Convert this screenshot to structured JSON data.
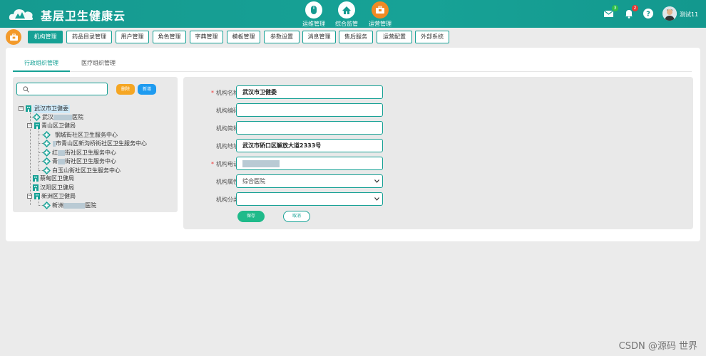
{
  "header": {
    "app_title": "基层卫生健康云",
    "nav": [
      {
        "label": "运维管理",
        "icon": "mouse-icon"
      },
      {
        "label": "综合监管",
        "icon": "home-icon"
      },
      {
        "label": "运营管理",
        "icon": "briefcase-icon",
        "active": true
      }
    ],
    "mail_count": "3",
    "notice_count": "2",
    "username": "测试11",
    "accent_color": "#16a195"
  },
  "module_tabs": [
    "机构管理",
    "药品目录管理",
    "用户管理",
    "角色管理",
    "字典管理",
    "模板管理",
    "参数设置",
    "消息管理",
    "售后服务",
    "运营配置",
    "外部系统"
  ],
  "sub_tabs": [
    "行政组织管理",
    "医疗组织管理"
  ],
  "tree": {
    "search_placeholder": "",
    "delete_label": "删除",
    "add_label": "新增",
    "nodes": [
      {
        "label": "武汉市卫健委",
        "selected": true
      },
      {
        "label": "武汉",
        "tail": "医院"
      },
      {
        "label": "青山区卫健局"
      },
      {
        "label": "钢城街社区卫生服务中心"
      },
      {
        "label": "",
        "prefix": "市青山区新沟桥街社区卫生服务中心"
      },
      {
        "label": "红",
        "tail": "街社区卫生服务中心"
      },
      {
        "label": "青",
        "tail": "街社区卫生服务中心"
      },
      {
        "label": "白玉山街社区卫生服务中心"
      },
      {
        "label": "蔡甸区卫健局"
      },
      {
        "label": "汉阳区卫健局"
      },
      {
        "label": "新洲区卫健局"
      },
      {
        "label": "新洲",
        "tail": "医院"
      }
    ]
  },
  "form": {
    "fields": [
      {
        "label": "机构名称",
        "value": "武汉市卫健委",
        "required": true
      },
      {
        "label": "机构编码",
        "value": ""
      },
      {
        "label": "机构简称",
        "value": ""
      },
      {
        "label": "机构地址",
        "value": "武汉市硚口区解放大道2333号"
      },
      {
        "label": "机构电话",
        "value": "",
        "required": true
      },
      {
        "label": "机构属性",
        "value": "综合医院",
        "type": "select"
      },
      {
        "label": "机构分类",
        "value": "",
        "type": "select"
      }
    ],
    "save_label": "保存",
    "cancel_label": "取消"
  },
  "watermark": "CSDN @源码 世界"
}
